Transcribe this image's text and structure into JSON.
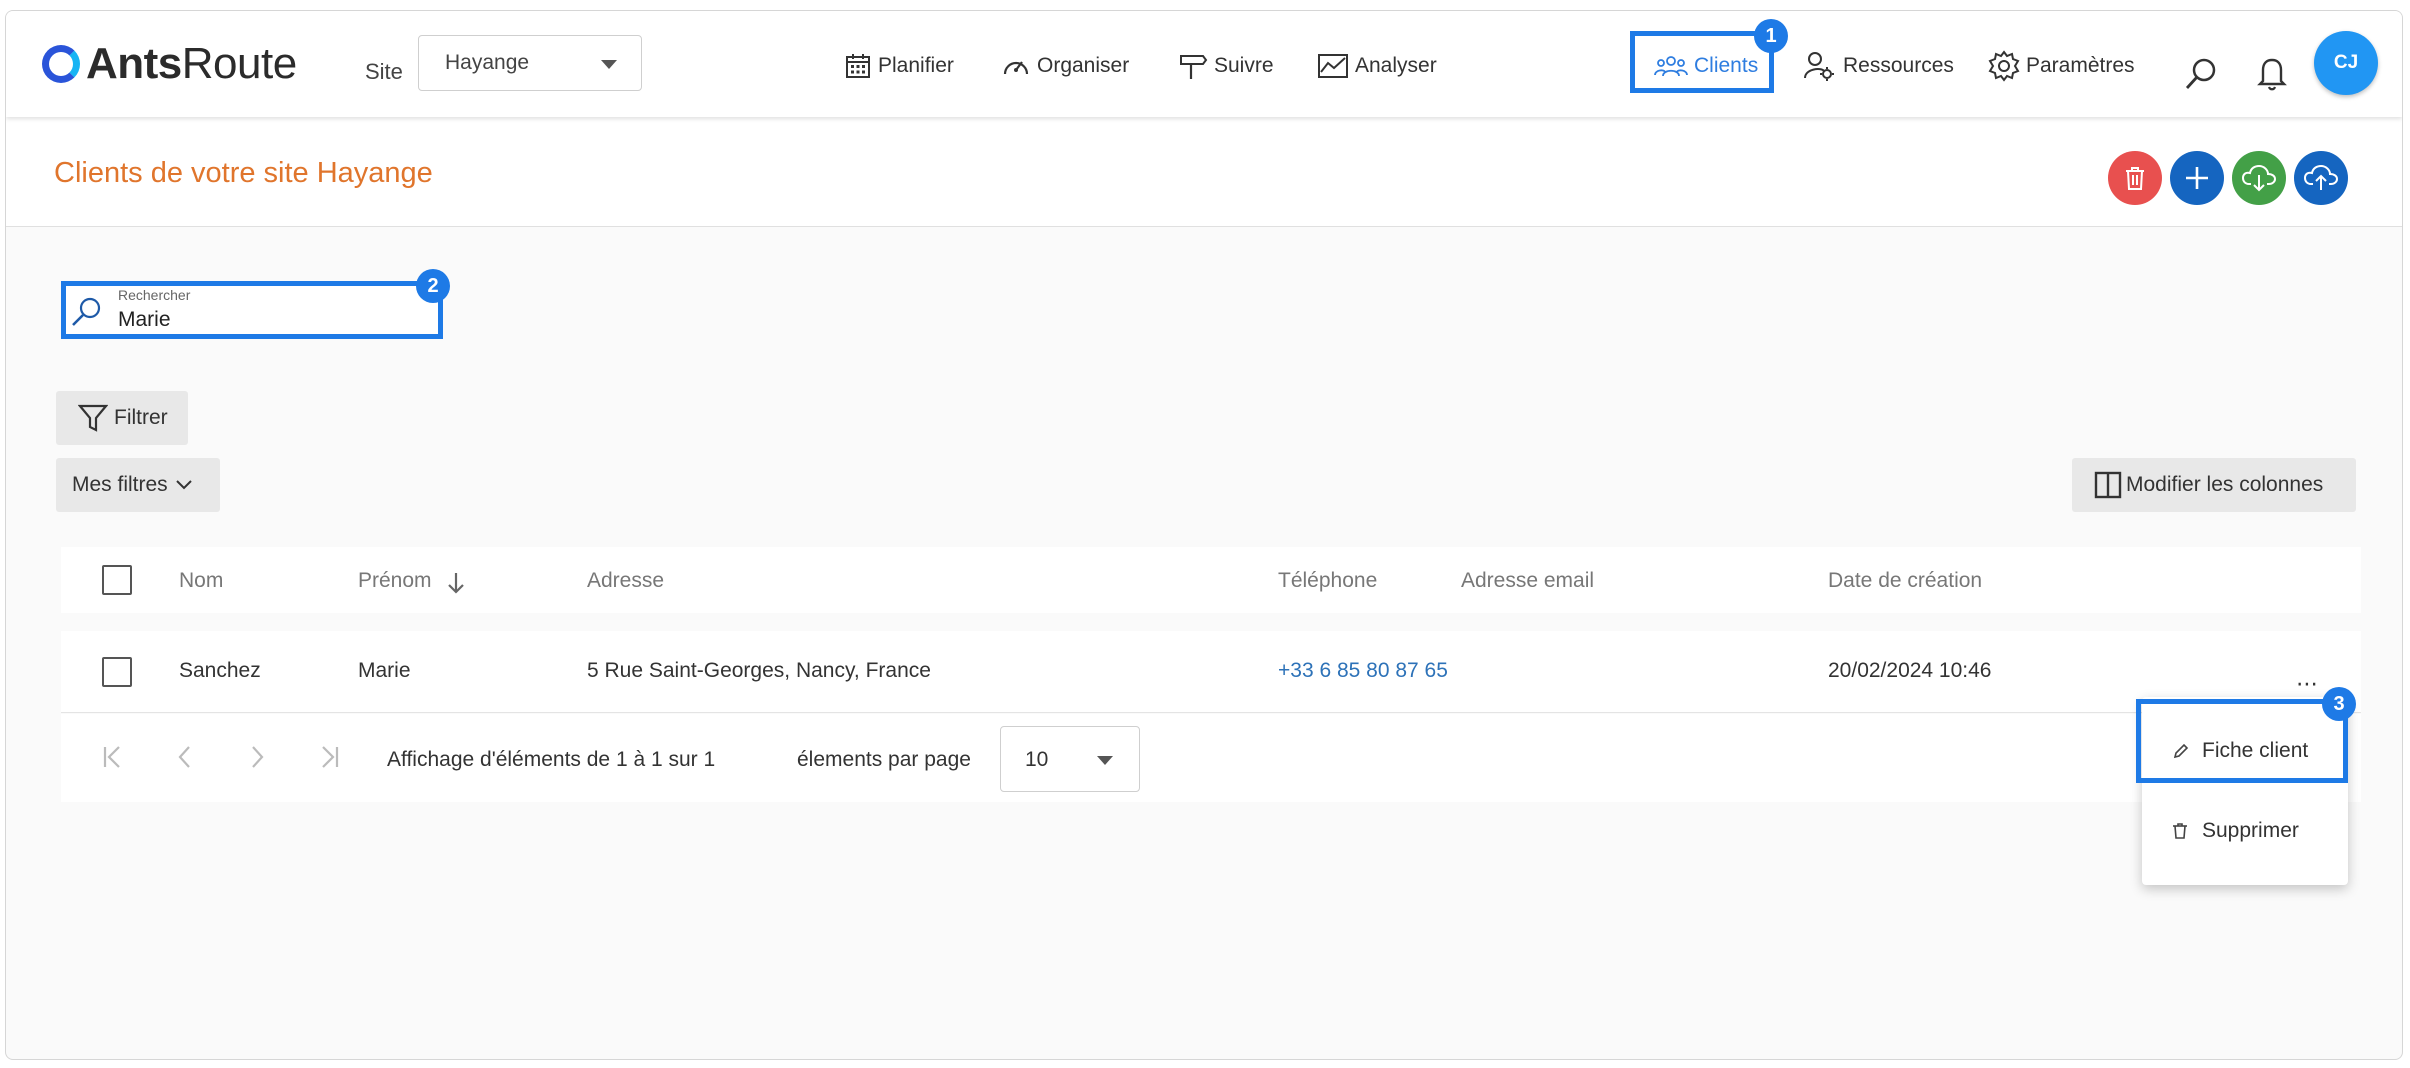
{
  "header": {
    "logo_bold": "Ants",
    "logo_light": "Route",
    "site_label": "Site",
    "site_value": "Hayange",
    "nav": {
      "planifier": "Planifier",
      "organiser": "Organiser",
      "suivre": "Suivre",
      "analyser": "Analyser",
      "clients": "Clients",
      "ressources": "Ressources",
      "parametres": "Paramètres"
    },
    "avatar_initials": "CJ"
  },
  "page": {
    "title": "Clients de votre site Hayange"
  },
  "search": {
    "label": "Rechercher",
    "value": "Marie"
  },
  "toolbar": {
    "filter_label": "Filtrer",
    "my_filters_label": "Mes filtres",
    "columns_label": "Modifier les colonnes"
  },
  "table": {
    "columns": [
      "Nom",
      "Prénom",
      "Adresse",
      "Téléphone",
      "Adresse email",
      "Date de création"
    ],
    "rows": [
      {
        "nom": "Sanchez",
        "prenom": "Marie",
        "adresse": "5 Rue Saint-Georges, Nancy, France",
        "telephone": "+33 6 85 80 87 65",
        "email": "",
        "date": "20/02/2024 10:46"
      }
    ]
  },
  "pagination": {
    "summary": "Affichage d'éléments de 1 à 1 sur 1",
    "per_page_label": "élements par page",
    "per_page_value": "10"
  },
  "context_menu": {
    "fiche_client": "Fiche client",
    "supprimer": "Supprimer"
  },
  "annotations": [
    "1",
    "2",
    "3"
  ],
  "colors": {
    "accent": "#1e7ae6",
    "title": "#e0752c",
    "delete": "#e8504f",
    "add": "#1565c0",
    "import": "#43a047",
    "export": "#1565c0"
  }
}
